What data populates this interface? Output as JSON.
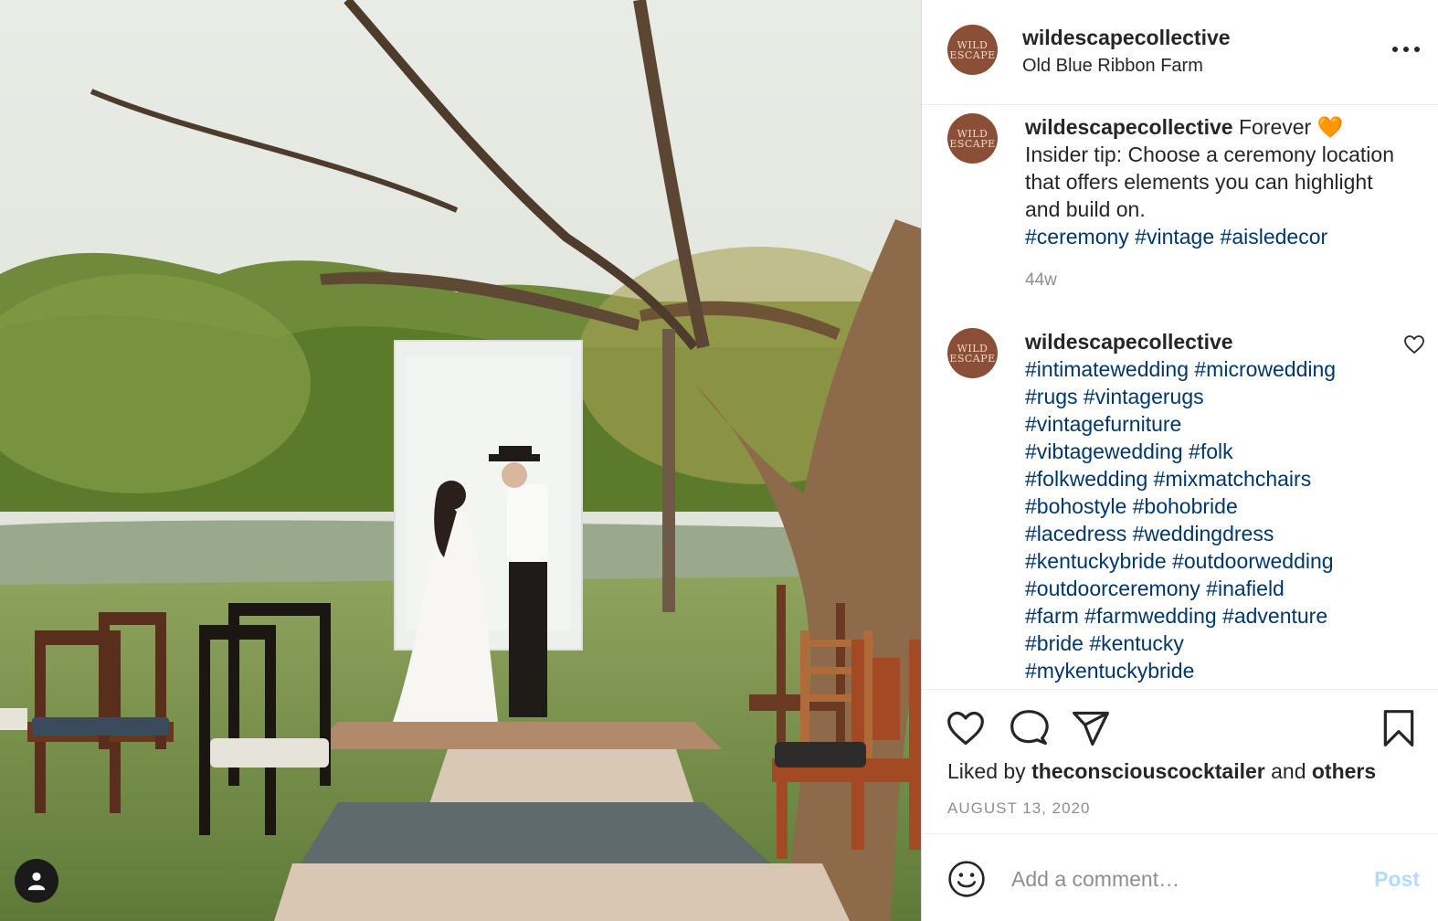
{
  "post": {
    "username": "wildescapecollective",
    "location": "Old Blue Ribbon Farm",
    "avatar_text_line1": "WILD",
    "avatar_text_line2": "ESCAPE"
  },
  "caption": {
    "username": "wildescapecollective",
    "text_line1": "Forever",
    "emoji": "🧡",
    "text_rest": "Insider tip: Choose a ceremony location that offers elements you can highlight and build on.",
    "tags": [
      "#ceremony",
      "#vintage",
      "#aisledecor"
    ],
    "time": "44w"
  },
  "comment": {
    "username": "wildescapecollective",
    "tag_lines": [
      "#intimatewedding #microwedding",
      "#rugs #vintagerugs",
      "#vintagefurniture",
      "#vibtagewedding #folk",
      "#folkwedding #mixmatchchairs",
      "#bohostyle #bohobride",
      "#lacedress #weddingdress",
      "#kentuckybride #outdoorwedding",
      "#outdoorceremony #inafield",
      "#farm #farmwedding #adventure",
      "#bride #kentucky",
      "#mykentuckybride"
    ]
  },
  "icons": {
    "like": "heart-icon",
    "comment": "comment-bubble-icon",
    "share": "paper-plane-icon",
    "save": "bookmark-icon",
    "more": "more-options-icon",
    "emoji": "smiley-icon",
    "user_tag": "person-icon"
  },
  "likes": {
    "prefix": "Liked by",
    "user": "theconsciouscocktailer",
    "middle": "and",
    "suffix": "others"
  },
  "date": "AUGUST 13, 2020",
  "add_comment": {
    "placeholder": "Add a comment…",
    "post_label": "Post"
  },
  "colors": {
    "text": "#262626",
    "hashtag": "#00376b",
    "muted": "#8e8e8e",
    "post_disabled": "#b3dbff",
    "avatar_bg": "#8a4f36"
  }
}
